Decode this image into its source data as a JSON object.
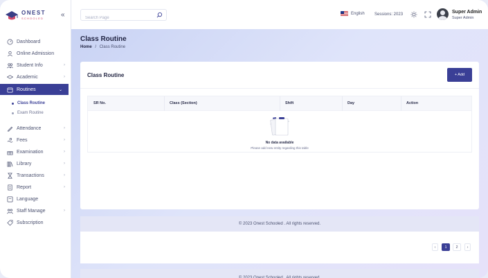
{
  "brand": {
    "name": "ONEST",
    "tagline": "SCHOOLED"
  },
  "colors": {
    "primary": "#3a3f96",
    "accent": "#d44a6a"
  },
  "sidebar": {
    "items": [
      {
        "label": "Dashboard",
        "icon": "dashboard-icon",
        "chevron": false
      },
      {
        "label": "Online Admission",
        "icon": "user-icon",
        "chevron": false
      },
      {
        "label": "Student Info",
        "icon": "users-icon",
        "chevron": true
      },
      {
        "label": "Academic",
        "icon": "graduation-cap-icon",
        "chevron": true
      },
      {
        "label": "Routines",
        "icon": "calendar-icon",
        "chevron": true,
        "active": true
      }
    ],
    "sub_items": [
      {
        "label": "Class Routine",
        "current": true
      },
      {
        "label": "Exam Routine",
        "current": false
      }
    ],
    "items_after": [
      {
        "label": "Attendance",
        "icon": "pen-icon",
        "chevron": true
      },
      {
        "label": "Fees",
        "icon": "coins-icon",
        "chevron": true
      },
      {
        "label": "Examination",
        "icon": "gift-icon",
        "chevron": true
      },
      {
        "label": "Library",
        "icon": "books-icon",
        "chevron": true
      },
      {
        "label": "Transactions",
        "icon": "hourglass-icon",
        "chevron": true
      },
      {
        "label": "Report",
        "icon": "report-icon",
        "chevron": true
      },
      {
        "label": "Language",
        "icon": "language-icon",
        "chevron": false
      },
      {
        "label": "Staff Manage",
        "icon": "staff-icon",
        "chevron": true
      },
      {
        "label": "Subscription",
        "icon": "tag-icon",
        "chevron": false
      }
    ]
  },
  "header": {
    "search_placeholder": "Search Page",
    "language": "English",
    "session": "Sessions: 2023",
    "user_name": "Super Admin",
    "user_role": "Super Admin"
  },
  "page": {
    "title": "Class Routine",
    "breadcrumb_home": "Home",
    "breadcrumb_sep": "/",
    "breadcrumb_current": "Class Routine"
  },
  "card": {
    "title": "Class Routine",
    "add_label": "+ Add",
    "columns": [
      "SR No.",
      "Class (Section)",
      "Shift",
      "Day",
      "Action"
    ],
    "empty_title": "No data available",
    "empty_sub": "Please add new entity regarding this table"
  },
  "footer": {
    "text": "© 2023 Onest Schooled . All rights reserved."
  },
  "pagination": {
    "prev": "‹",
    "pages": [
      "1",
      "2"
    ],
    "current": "1",
    "next": "›"
  }
}
